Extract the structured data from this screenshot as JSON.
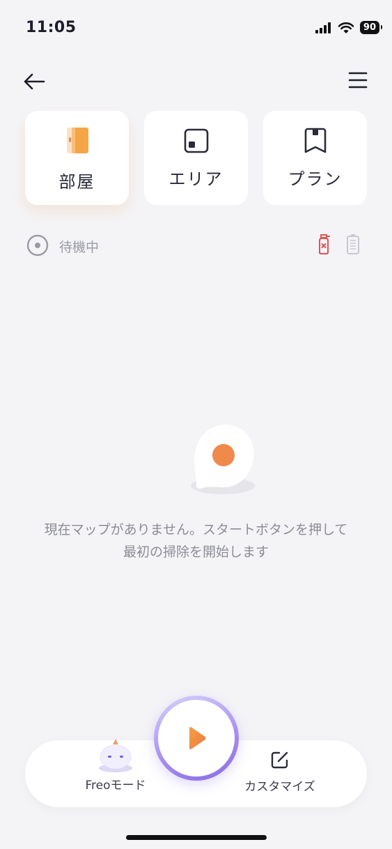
{
  "status_bar": {
    "time": "11:05",
    "battery": "90"
  },
  "mode_tabs": [
    {
      "label": "部屋",
      "icon": "room-icon",
      "active": true
    },
    {
      "label": "エリア",
      "icon": "area-icon",
      "active": false
    },
    {
      "label": "プラン",
      "icon": "plan-bookmark-icon",
      "active": false
    }
  ],
  "status": {
    "text": "待機中"
  },
  "map": {
    "empty_message_line1": "現在マップがありません。スタートボタンを押して",
    "empty_message_line2": "最初の掃除を開始します"
  },
  "bottom_bar": {
    "freo_label": "Freoモード",
    "customize_label": "カスタマイズ"
  },
  "colors": {
    "accent_orange": "#f08a4b",
    "accent_purple": "#9a7cf0",
    "warning_red": "#e05252"
  }
}
